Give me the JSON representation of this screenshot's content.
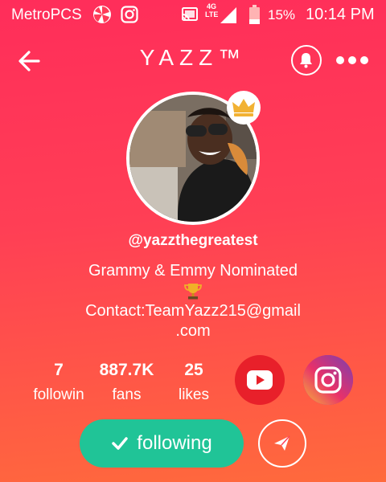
{
  "status_bar": {
    "carrier": "MetroPCS",
    "network_type_top": "4G",
    "network_type_bottom": "LTE",
    "battery": "15%",
    "time": "10:14 PM"
  },
  "header": {
    "title": "YAZZ™"
  },
  "profile": {
    "username": "@yazzthegreatest",
    "bio_line1": "Grammy & Emmy Nominated",
    "bio_line3": "Contact:TeamYazz215@gmail",
    "bio_line4": ".com"
  },
  "stats": [
    {
      "value": "7",
      "label": "followin"
    },
    {
      "value": "887.7K",
      "label": "fans"
    },
    {
      "value": "25",
      "label": "likes"
    }
  ],
  "actions": {
    "follow_label": "following"
  },
  "colors": {
    "background_top": "#ff2d5a",
    "background_bottom": "#ff6a3c",
    "following_button": "#20c497",
    "youtube": "#e8202a",
    "crown": "#f2b233"
  }
}
